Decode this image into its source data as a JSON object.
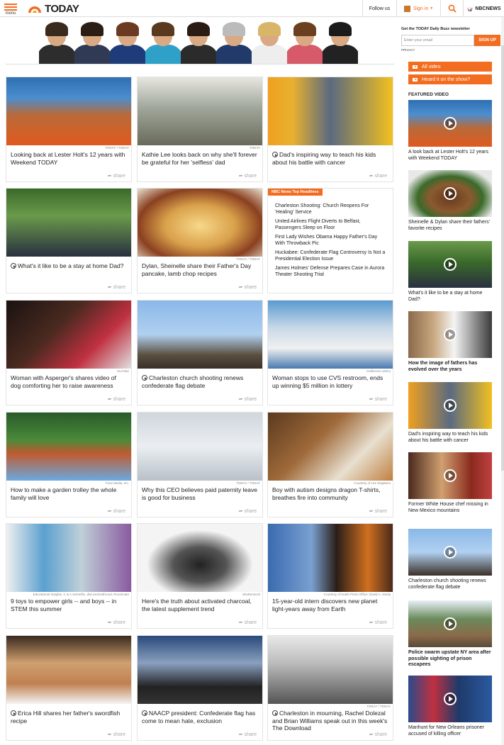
{
  "header": {
    "menu_label": "menu",
    "logo": "TODAY",
    "follow": "Follow us",
    "signin": "Sign in",
    "network": "NBCNEWS"
  },
  "newsletter": {
    "title": "Get the TODAY Daily Buzz newsletter",
    "placeholder": "Enter your email",
    "button": "SIGN UP",
    "privacy": "PRIVACY"
  },
  "sidebar": {
    "all_video": "All video",
    "heard": "Heard it on the show?",
    "featured": "FEATURED VIDEO",
    "videos": [
      {
        "caption": "A look back at Lester Holt's 12 years with Weekend TODAY",
        "bold": false
      },
      {
        "caption": "Sheinelle & Dylan share their fathers' favorite recipes",
        "bold": false
      },
      {
        "caption": "What's it like to be a stay at home Dad?",
        "bold": false
      },
      {
        "caption": "How the image of fathers has evolved over the years",
        "bold": true
      },
      {
        "caption": "Dad's inspiring way to teach his kids about his battle with cancer",
        "bold": false
      },
      {
        "caption": "Former White House chef missing in New Mexico mountains",
        "bold": false
      },
      {
        "caption": "Charleston church shooting renews confederate flag debate",
        "bold": false
      },
      {
        "caption": "Police swarm upstate NY area after possible sighting of prison escapees",
        "bold": true
      },
      {
        "caption": "Manhunt for New Orleans prisoner accused of killing officer",
        "bold": false
      }
    ]
  },
  "cards": [
    {
      "title": "Looking back at Lester Holt's 12 years with Weekend TODAY",
      "credit": "TODAY / TODAY",
      "video": false
    },
    {
      "title": "Kathie Lee looks back on why she'll forever be grateful for her 'selfless' dad",
      "credit": "TODAY",
      "video": false
    },
    {
      "title": "Dad's inspiring way to teach his kids about his battle with cancer",
      "credit": "",
      "video": true
    },
    {
      "title": "What's it like to be a stay at home Dad?",
      "credit": "",
      "video": true
    },
    {
      "title": "Dylan, Sheinelle share their Father's Day pancake, lamb chop recipes",
      "credit": "TODAY / TODAY",
      "video": false
    },
    null,
    {
      "title": "Woman with Asperger's shares video of dog comforting her to raise awareness",
      "credit": "YouTube",
      "video": false
    },
    {
      "title": "Charleston church shooting renews confederate flag debate",
      "credit": "",
      "video": true
    },
    {
      "title": "Woman stops to use CVS restroom, ends up winning $5 million in lottery",
      "credit": "California Lottery",
      "video": false
    },
    {
      "title": "How to make a garden trolley the whole family will love",
      "credit": "Frew Media, Inc.",
      "video": false
    },
    {
      "title": "Why this CEO believes paid paternity leave is good for business",
      "credit": "TODAY / TODAY",
      "video": false
    },
    {
      "title": "Boy with autism designs dragon T-shirts, breathes fire into community",
      "credit": "Courtesy of Lee Stagliano",
      "video": false
    },
    {
      "title": "9 toys to empower girls -- and boys -- in STEM this summer",
      "credit": "Educational Insights, C & A Scientific, discoveriesthroud, Roominate",
      "video": false
    },
    {
      "title": "Here's the truth about activated charcoal, the latest supplement trend",
      "credit": "Shutterstock",
      "video": false
    },
    {
      "title": "15-year-old intern discovers new planet light-years away from Earth",
      "credit": "Courtesy of Keele Press Office; David A. Hardy",
      "video": false
    },
    {
      "title": "Erica Hill shares her father's swordfish recipe",
      "credit": "",
      "video": true
    },
    {
      "title": "NAACP president: Confederate flag has come to mean hate, exclusion",
      "credit": "",
      "video": true
    },
    {
      "title": "Charleston in mourning, Rachel Dolezal and Brian Williams speak out in this week's The Download",
      "credit": "TODAY / TODAY",
      "video": true
    }
  ],
  "share_label": "share",
  "headlines": {
    "badge": "NBC News Top Headlines",
    "items": [
      "Charleston Shooting: Church Reopens For 'Healing' Service",
      "United Airlines Flight Diverts to Belfast, Passengers Sleep on Floor",
      "First Lady Wishes Obama Happy Father's Day With Throwback Pic",
      "Huckabee: Confederate Flag Controversy Is Not a Presidential Election Issue",
      "James Holmes' Defense Prepares Case in Aurora Theater Shooting Trial"
    ]
  },
  "colors": {
    "accent": "#f36d21"
  }
}
